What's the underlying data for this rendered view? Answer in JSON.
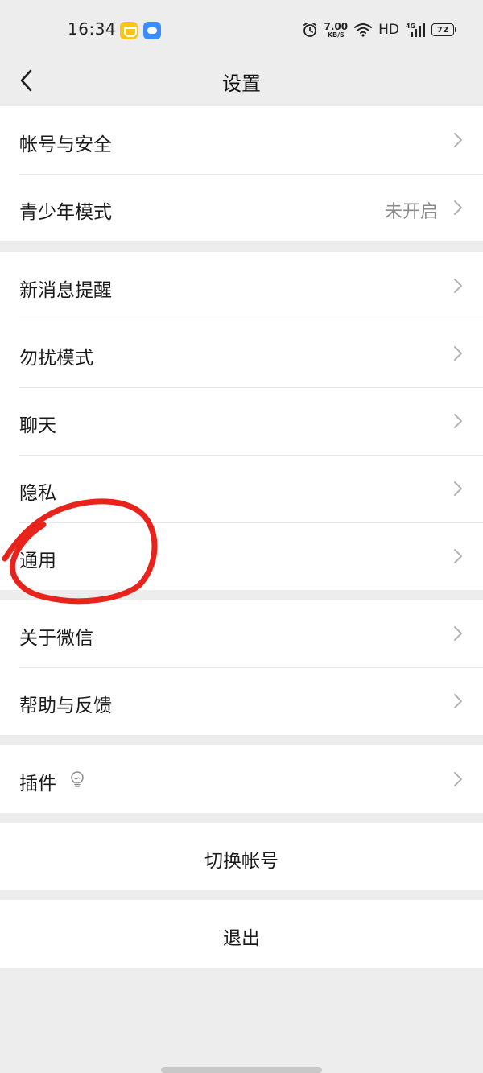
{
  "status_bar": {
    "time": "16:34",
    "net_speed_value": "7.00",
    "net_speed_unit": "KB/S",
    "network": "HD",
    "network_type": "4G",
    "battery": "72",
    "icons": [
      "app-notification-icon",
      "message-notification-icon",
      "alarm-icon",
      "wifi-icon",
      "signal-icon",
      "battery-icon"
    ]
  },
  "nav": {
    "title": "设置",
    "back_icon": "chevron-left-icon"
  },
  "groups": [
    {
      "items": [
        {
          "label": "帐号与安全"
        },
        {
          "label": "青少年模式",
          "value": "未开启"
        }
      ]
    },
    {
      "items": [
        {
          "label": "新消息提醒"
        },
        {
          "label": "勿扰模式"
        },
        {
          "label": "聊天"
        },
        {
          "label": "隐私"
        },
        {
          "label": "通用"
        }
      ]
    },
    {
      "items": [
        {
          "label": "关于微信"
        },
        {
          "label": "帮助与反馈"
        }
      ]
    },
    {
      "items": [
        {
          "label": "插件",
          "icon": "lightbulb-icon"
        }
      ]
    }
  ],
  "actions": {
    "switch_account": "切换帐号",
    "logout": "退出"
  },
  "colors": {
    "background": "#ededed",
    "card": "#ffffff",
    "secondary_text": "#8a8a8a",
    "annotation": "#e8231c"
  }
}
